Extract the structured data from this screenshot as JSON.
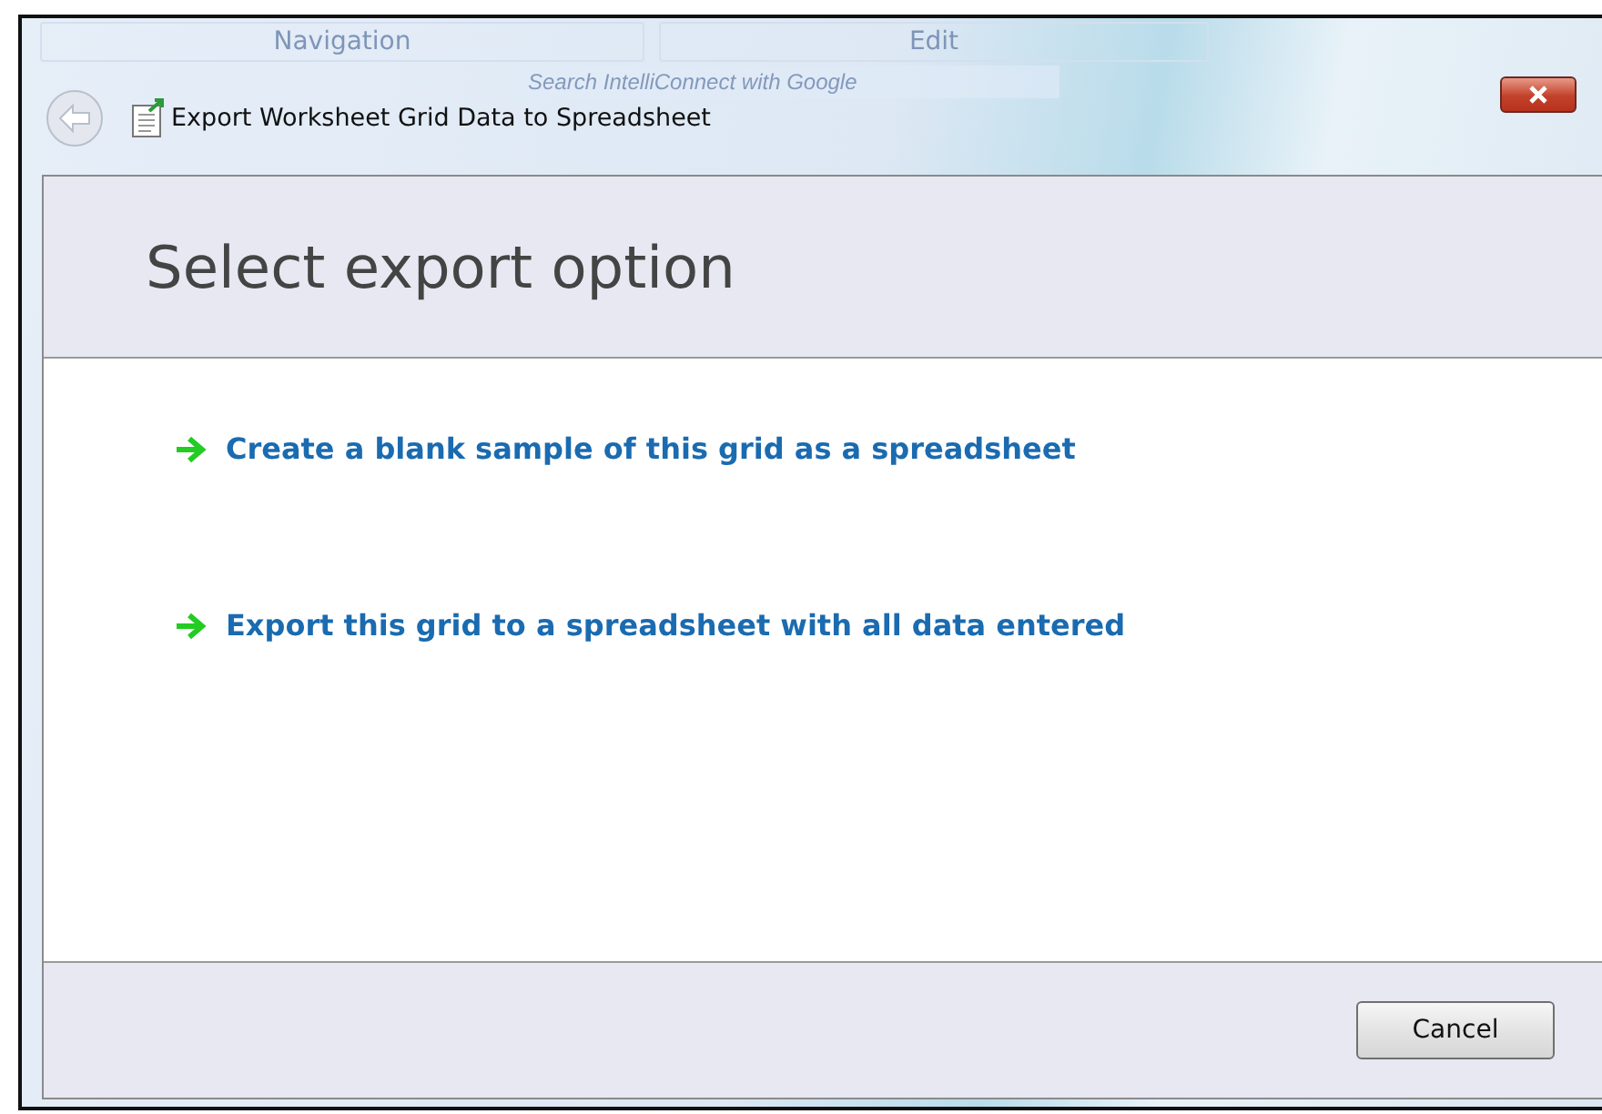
{
  "backdrop": {
    "tabs": [
      "Navigation",
      "Edit"
    ],
    "search": {
      "placeholder": "Search IntelliConnect with Google"
    }
  },
  "window": {
    "title": "Export Worksheet Grid Data to Spreadsheet"
  },
  "header": {
    "title": "Select export option"
  },
  "options": [
    {
      "label": "Create a blank sample of this grid as a spreadsheet"
    },
    {
      "label": "Export this grid to a spreadsheet with all data entered"
    }
  ],
  "buttons": [
    "Cancel"
  ]
}
